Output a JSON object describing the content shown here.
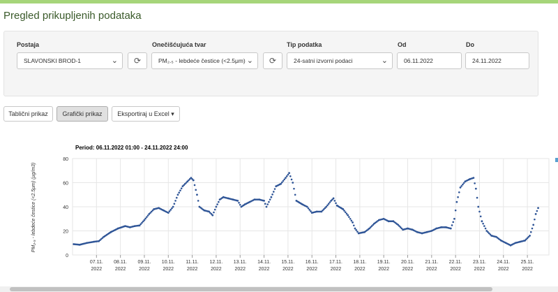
{
  "page": {
    "title": "Pregled prikupljenih podataka"
  },
  "filters": {
    "station_label": "Postaja",
    "station_value": "SLAVONSKI BROD-1",
    "pollutant_label": "Onečišćujuća tvar",
    "pollutant_value": "PM₂.₅ - lebdeće čestice (<2.5μm)",
    "type_label": "Tip podatka",
    "type_value": "24-satni izvorni podaci",
    "from_label": "Od",
    "from_value": "06.11.2022",
    "to_label": "Do",
    "to_value": "24.11.2022",
    "chevron_icon": "chevron-down-icon",
    "refresh_icon": "refresh-icon"
  },
  "toolbar": {
    "table_view": "Tablični prikaz",
    "chart_view": "Grafički prikaz",
    "export": "Eksportiraj u Excel",
    "export_caret": "▾"
  },
  "chart_data": {
    "type": "scatter",
    "title": "Period: 06.11.2022 01:00 - 24.11.2022 24:00",
    "xlabel": "",
    "ylabel": "PM₂.₅ - lebdeće čestice (<2.5μm) (μg/m3)",
    "ylim": [
      0,
      80
    ],
    "yticks": [
      0,
      20,
      40,
      60,
      80
    ],
    "xlim": [
      6.0,
      25.9
    ],
    "xtick_positions": [
      7,
      8,
      9,
      10,
      11,
      12,
      13,
      14,
      15,
      16,
      17,
      18,
      19,
      20,
      21,
      22,
      23,
      24,
      25
    ],
    "xtick_labels": [
      [
        "07.11.",
        "2022"
      ],
      [
        "08.11.",
        "2022"
      ],
      [
        "09.11.",
        "2022"
      ],
      [
        "10.11.",
        "2022"
      ],
      [
        "11.11.",
        "2022"
      ],
      [
        "12.11.",
        "2022"
      ],
      [
        "13.11.",
        "2022"
      ],
      [
        "14.11.",
        "2022"
      ],
      [
        "15.11.",
        "2022"
      ],
      [
        "16.11.",
        "2022"
      ],
      [
        "17.11.",
        "2022"
      ],
      [
        "18.11.",
        "2022"
      ],
      [
        "19.11.",
        "2022"
      ],
      [
        "20.11.",
        "2022"
      ],
      [
        "21.11.",
        "2022"
      ],
      [
        "22.11.",
        "2022"
      ],
      [
        "23.11.",
        "2022"
      ],
      [
        "24.11.",
        "2022"
      ],
      [
        "25.11.",
        "2022"
      ]
    ],
    "grid": true,
    "series": [
      {
        "color": "#2f5597",
        "points": [
          [
            6.05,
            9
          ],
          [
            6.3,
            8.5
          ],
          [
            6.6,
            10
          ],
          [
            6.9,
            11
          ],
          [
            7.1,
            11.5
          ],
          [
            7.3,
            15
          ],
          [
            7.6,
            19
          ],
          [
            7.9,
            22
          ],
          [
            8.2,
            24
          ],
          [
            8.4,
            23
          ],
          [
            8.6,
            24
          ],
          [
            8.8,
            24.5
          ],
          [
            9.0,
            29
          ],
          [
            9.2,
            34
          ],
          [
            9.4,
            38
          ],
          [
            9.6,
            39
          ],
          [
            9.8,
            37
          ],
          [
            10.0,
            35
          ],
          [
            10.2,
            40
          ],
          [
            10.4,
            50
          ],
          [
            10.6,
            57
          ],
          [
            10.8,
            61
          ],
          [
            10.95,
            64
          ],
          [
            11.05,
            62
          ],
          [
            11.2,
            50
          ],
          [
            11.3,
            40
          ],
          [
            11.5,
            37
          ],
          [
            11.7,
            36
          ],
          [
            11.85,
            33
          ],
          [
            12.0,
            40
          ],
          [
            12.15,
            46
          ],
          [
            12.3,
            48
          ],
          [
            12.5,
            47
          ],
          [
            12.7,
            46
          ],
          [
            12.9,
            45
          ],
          [
            13.05,
            40
          ],
          [
            13.2,
            42
          ],
          [
            13.4,
            44
          ],
          [
            13.6,
            46
          ],
          [
            13.8,
            46
          ],
          [
            14.0,
            45
          ],
          [
            14.1,
            40
          ],
          [
            14.3,
            48
          ],
          [
            14.5,
            57
          ],
          [
            14.7,
            59
          ],
          [
            14.9,
            64
          ],
          [
            15.05,
            68
          ],
          [
            15.2,
            60
          ],
          [
            15.35,
            45
          ],
          [
            15.6,
            42
          ],
          [
            15.8,
            40
          ],
          [
            16.0,
            35
          ],
          [
            16.2,
            36
          ],
          [
            16.4,
            36
          ],
          [
            16.6,
            40
          ],
          [
            16.8,
            45
          ],
          [
            16.9,
            47
          ],
          [
            17.05,
            41
          ],
          [
            17.3,
            38
          ],
          [
            17.5,
            33
          ],
          [
            17.7,
            27
          ],
          [
            17.8,
            22
          ],
          [
            17.95,
            18
          ],
          [
            18.2,
            19
          ],
          [
            18.4,
            22
          ],
          [
            18.6,
            26
          ],
          [
            18.8,
            29
          ],
          [
            19.0,
            30
          ],
          [
            19.2,
            28
          ],
          [
            19.4,
            28
          ],
          [
            19.6,
            25
          ],
          [
            19.8,
            21
          ],
          [
            20.0,
            22
          ],
          [
            20.2,
            21
          ],
          [
            20.4,
            19
          ],
          [
            20.6,
            18
          ],
          [
            20.8,
            19
          ],
          [
            21.0,
            20
          ],
          [
            21.2,
            22
          ],
          [
            21.4,
            23
          ],
          [
            21.6,
            23
          ],
          [
            21.8,
            22
          ],
          [
            21.95,
            30
          ],
          [
            22.05,
            44
          ],
          [
            22.2,
            56
          ],
          [
            22.4,
            61
          ],
          [
            22.6,
            63
          ],
          [
            22.75,
            64
          ],
          [
            22.85,
            55
          ],
          [
            22.95,
            40
          ],
          [
            23.1,
            28
          ],
          [
            23.3,
            20
          ],
          [
            23.5,
            16
          ],
          [
            23.7,
            15
          ],
          [
            23.9,
            12
          ],
          [
            24.1,
            10
          ],
          [
            24.3,
            8
          ],
          [
            24.5,
            10
          ],
          [
            24.7,
            11
          ],
          [
            24.9,
            12
          ],
          [
            25.1,
            16
          ],
          [
            25.25,
            25
          ],
          [
            25.35,
            34
          ],
          [
            25.45,
            39
          ]
        ]
      }
    ]
  }
}
